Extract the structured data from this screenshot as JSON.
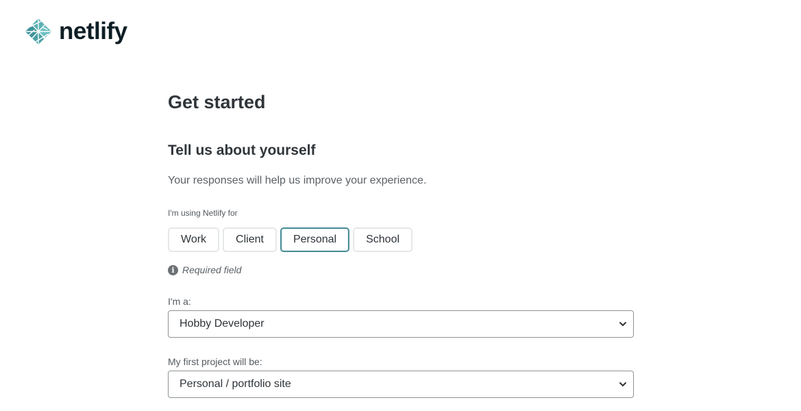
{
  "brand": {
    "name": "netlify",
    "logo_color": "#4ca1a6"
  },
  "page": {
    "title": "Get started"
  },
  "section": {
    "title": "Tell us about yourself",
    "description": "Your responses will help us improve your experience."
  },
  "usage": {
    "label": "I'm using Netlify for",
    "options": [
      "Work",
      "Client",
      "Personal",
      "School"
    ],
    "selected": "Personal",
    "required_text": "Required field",
    "accent_color": "#4a8e97"
  },
  "role": {
    "label": "I'm a:",
    "value": "Hobby Developer"
  },
  "project": {
    "label": "My first project will be:",
    "value": "Personal / portfolio site"
  }
}
